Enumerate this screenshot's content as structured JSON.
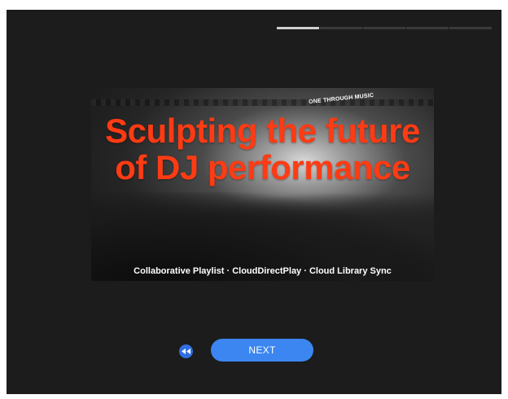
{
  "progress": {
    "total_steps": 5,
    "current_step": 1
  },
  "slide": {
    "heading": "Sculpting the future of DJ performance",
    "tagline": "ONE THROUGH MUSIC",
    "caption": "Collaborative Playlist · CloudDirectPlay · Cloud Library Sync"
  },
  "controls": {
    "prev_icon": "rewind-icon",
    "next_label": "NEXT"
  },
  "colors": {
    "background": "#1c1c1c",
    "heading": "#ff3b14",
    "accent": "#3b86f0",
    "progress_active": "#cfcfcf",
    "progress_inactive": "#3a3a3a"
  }
}
